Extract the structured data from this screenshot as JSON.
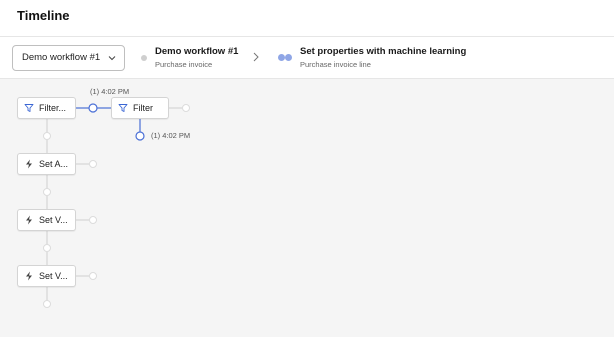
{
  "page": {
    "title": "Timeline"
  },
  "toolbar": {
    "workflow_select": {
      "value": "Demo workflow #1"
    },
    "steps": [
      {
        "name": "Demo workflow #1",
        "sub": "Purchase invoice"
      },
      {
        "name": "Set properties with machine learning",
        "sub": "Purchase invoice line"
      }
    ]
  },
  "canvas": {
    "nodes": [
      {
        "label": "Filter...",
        "icon": "filter-icon"
      },
      {
        "label": "Filter",
        "icon": "filter-icon"
      },
      {
        "label": "Set A...",
        "icon": "bolt-icon"
      },
      {
        "label": "Set V...",
        "icon": "bolt-icon"
      },
      {
        "label": "Set V...",
        "icon": "bolt-icon"
      }
    ],
    "timestamps": [
      "(1) 4:02 PM",
      "(1) 4:02 PM"
    ]
  },
  "colors": {
    "accent": "#4a6fd6",
    "connector": "#dcdcdc",
    "canvas_bg": "#f5f5f5"
  }
}
